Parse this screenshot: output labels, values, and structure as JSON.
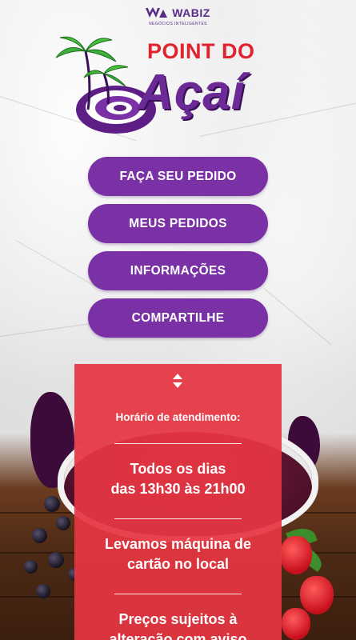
{
  "brand": {
    "name": "WABIZ",
    "tagline": "NEGÓCIOS INTELIGENTES"
  },
  "logo": {
    "line1": "POINT DO",
    "line2": "Açaí"
  },
  "menu": {
    "items": [
      {
        "label": "FAÇA SEU PEDIDO"
      },
      {
        "label": "MEUS PEDIDOS"
      },
      {
        "label": "INFORMAÇÕES"
      },
      {
        "label": "COMPARTILHE"
      }
    ]
  },
  "info_panel": {
    "toggle_icon": "expand-collapse-arrows-icon",
    "heading": "Horário de atendimento:",
    "hours_line1": "Todos os dias",
    "hours_line2": "das 13h30 às 21h00",
    "payment_line1": "Levamos máquina de",
    "payment_line2": "cartão no local",
    "prices_line1": "Preços sujeitos à",
    "prices_line2": "alteração com aviso"
  },
  "colors": {
    "accent_purple": "#7a31a6",
    "panel_red": "#e63642",
    "title_red": "#e0232e",
    "logo_purple": "#6c2a97"
  }
}
